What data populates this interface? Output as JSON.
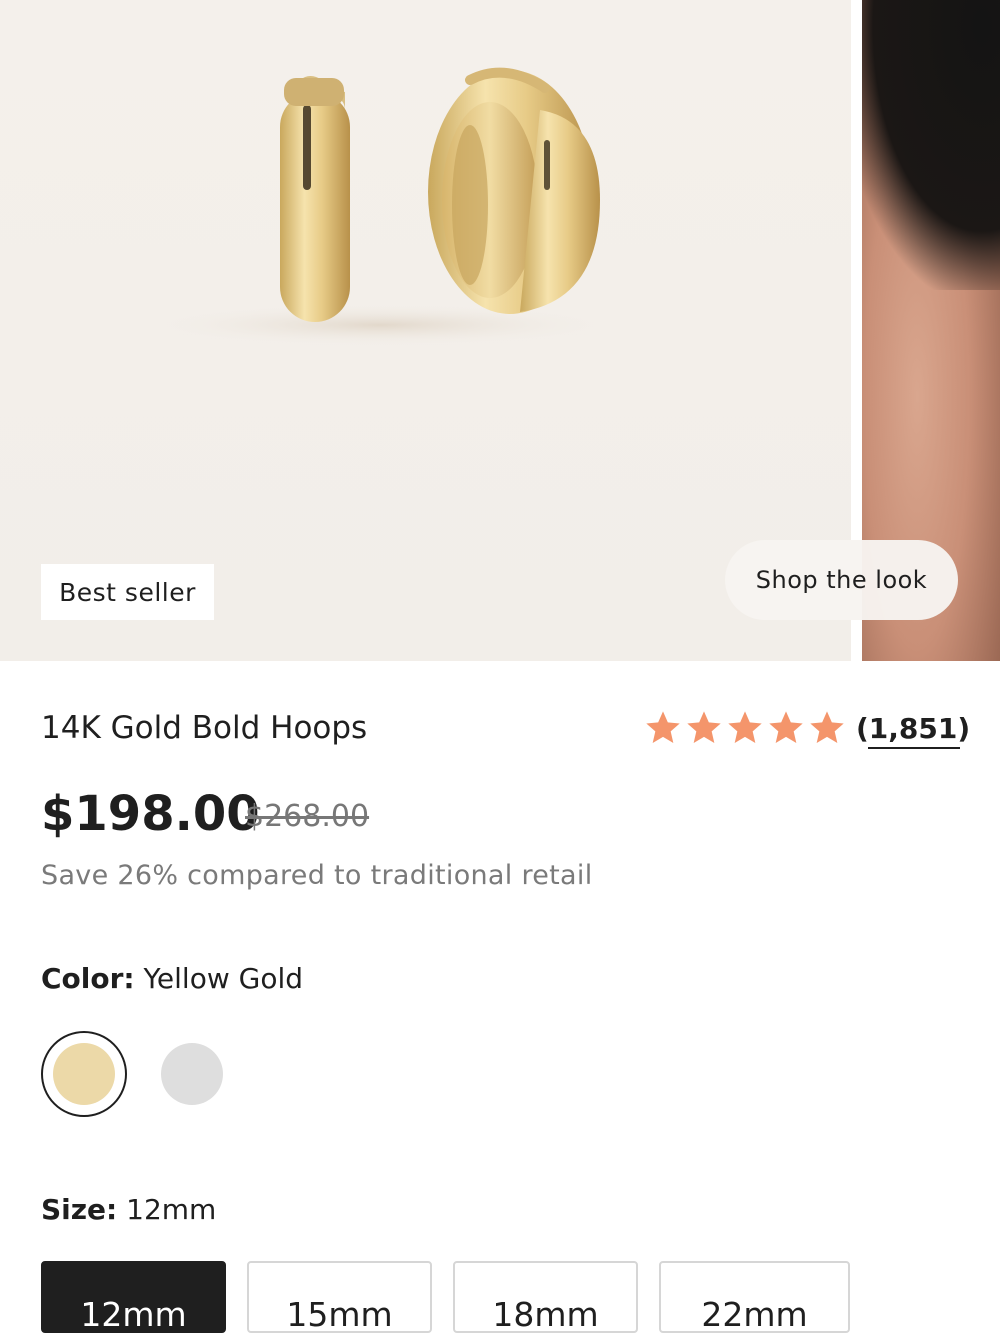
{
  "gallery": {
    "badge": "Best seller",
    "shop_the_look": "Shop the look"
  },
  "product": {
    "title": "14K Gold Bold Hoops",
    "rating": {
      "stars": 5,
      "review_count": "(1,851)",
      "star_color": "#f4956b"
    },
    "price": "$198.00",
    "compare_price": "$268.00",
    "savings": "Save 26% compared to traditional retail"
  },
  "color": {
    "label": "Color:",
    "selected": "Yellow Gold",
    "swatches": [
      {
        "name": "yellow-gold",
        "hex": "#ecd9a8"
      },
      {
        "name": "silver",
        "hex": "#dedede"
      }
    ]
  },
  "size": {
    "label": "Size:",
    "selected": "12mm",
    "options": [
      "12mm",
      "15mm",
      "18mm",
      "22mm"
    ]
  }
}
